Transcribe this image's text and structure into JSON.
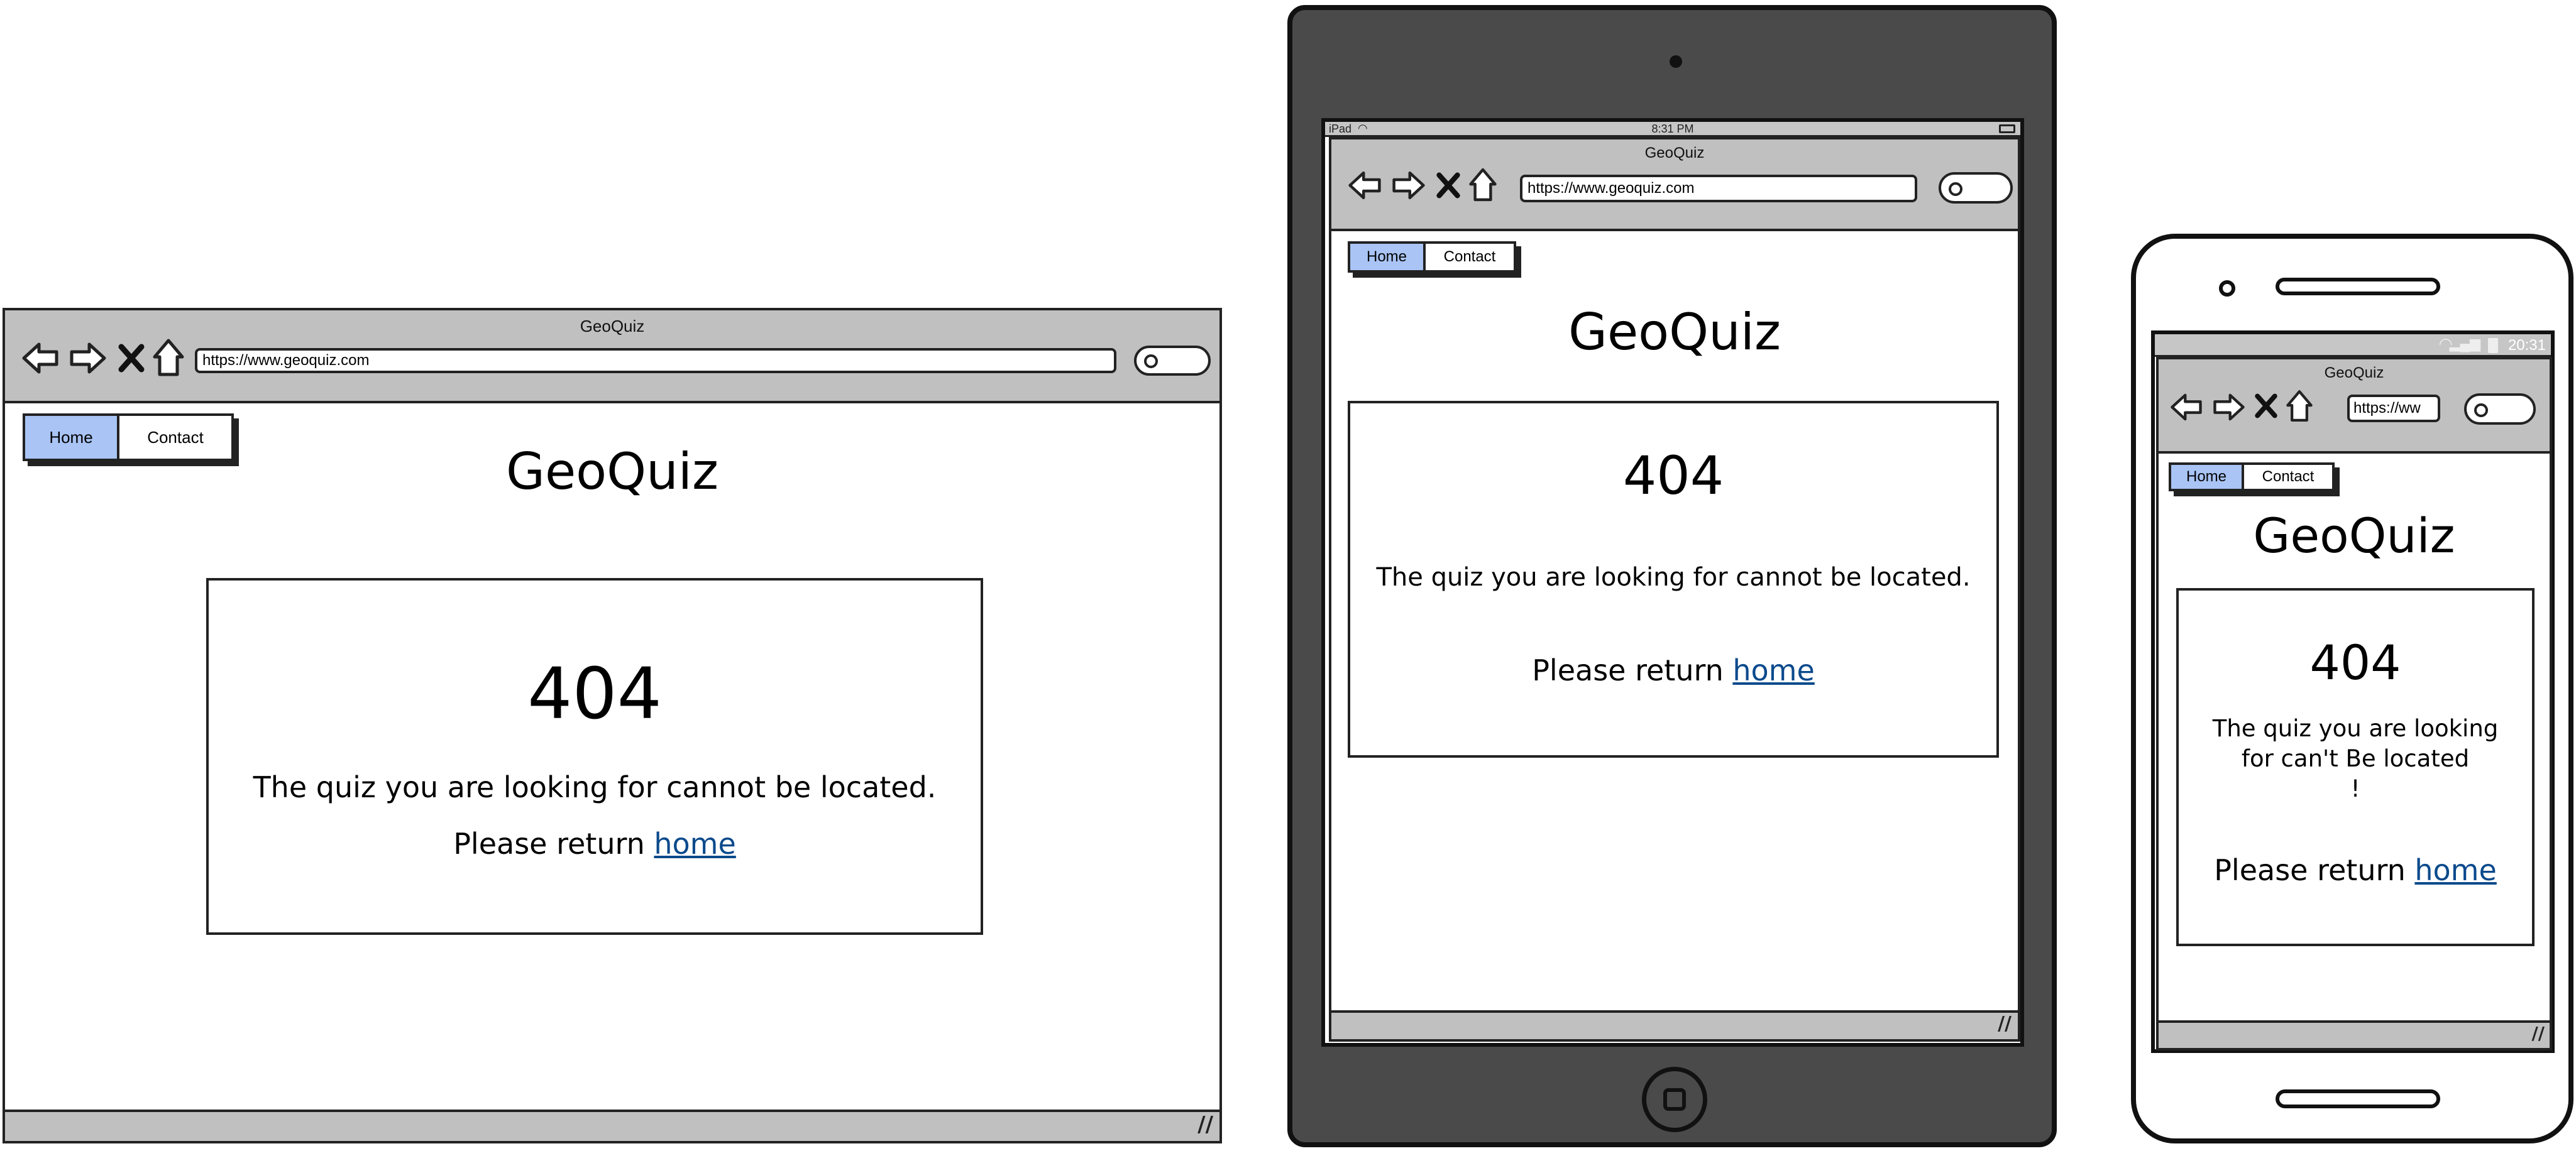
{
  "colors": {
    "chrome_gray": "#c0c0c0",
    "active_menu": "#a9c4f5",
    "link": "#0b4a8c",
    "tablet_body": "#4a4a4a",
    "outline": "#222222"
  },
  "desktop": {
    "window_title": "GeoQuiz",
    "url": "https://www.geoquiz.com",
    "menu": {
      "home": "Home",
      "contact": "Contact"
    },
    "heading": "GeoQuiz",
    "card": {
      "code": "404",
      "message": "The quiz you are looking for cannot be located.",
      "return_text": "Please return",
      "return_link": "home"
    }
  },
  "tablet": {
    "status": {
      "device": "iPad",
      "time": "8:31 PM"
    },
    "window_title": "GeoQuiz",
    "url": "https://www.geoquiz.com",
    "menu": {
      "home": "Home",
      "contact": "Contact"
    },
    "heading": "GeoQuiz",
    "card": {
      "code": "404",
      "message": "The quiz you are looking for cannot be located.",
      "return_text": "Please return",
      "return_link": "home"
    }
  },
  "phone": {
    "status": {
      "time": "20:31"
    },
    "window_title": "GeoQuiz",
    "url": "https://ww",
    "menu": {
      "home": "Home",
      "contact": "Contact"
    },
    "heading": "GeoQuiz",
    "card": {
      "code": "404",
      "message_line1": "The quiz you are looking",
      "message_line2": "for can't Be located",
      "message_line3": "!",
      "return_text": "Please return",
      "return_link": "home"
    }
  },
  "icons": [
    "back-arrow-icon",
    "forward-arrow-icon",
    "stop-icon",
    "home-icon",
    "search-icon",
    "resize-grip-icon",
    "wifi-icon",
    "battery-icon",
    "signal-icon",
    "home-button-icon",
    "camera-icon",
    "speaker-icon"
  ]
}
